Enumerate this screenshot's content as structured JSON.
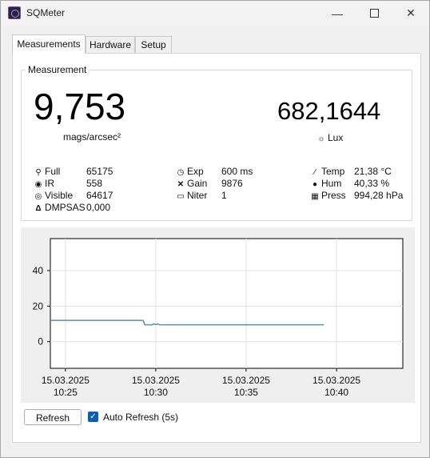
{
  "window": {
    "title": "SQMeter"
  },
  "tabs": [
    {
      "label": "Measurements",
      "active": true
    },
    {
      "label": "Hardware",
      "active": false
    },
    {
      "label": "Setup",
      "active": false
    }
  ],
  "measurement": {
    "group_label": "Measurement",
    "mags_value": "9,753",
    "mags_unit": "mags/arcsec²",
    "lux_value": "682,1644",
    "lux_unit": "Lux",
    "sensor": [
      {
        "icon": "bulb-icon",
        "label": "Full",
        "value": "65175"
      },
      {
        "icon": "ir-icon",
        "label": "IR",
        "value": "558"
      },
      {
        "icon": "eye-icon",
        "label": "Visible",
        "value": "64617"
      },
      {
        "icon": "delta-icon",
        "label": "DMPSAS",
        "value": "0,000"
      }
    ],
    "settings": [
      {
        "icon": "clock-icon",
        "label": "Exp",
        "value": "600 ms"
      },
      {
        "icon": "gain-icon",
        "label": "Gain",
        "value": "9876"
      },
      {
        "icon": "iter-icon",
        "label": "Niter",
        "value": "1"
      }
    ],
    "environment": [
      {
        "icon": "thermometer-icon",
        "label": "Temp",
        "value": "21,38 °C"
      },
      {
        "icon": "drop-icon",
        "label": "Hum",
        "value": "40,33 %"
      },
      {
        "icon": "pressure-icon",
        "label": "Press",
        "value": "994,28 hPa"
      }
    ]
  },
  "chart_data": {
    "type": "line",
    "y_ticks": [
      "0",
      "20",
      "40"
    ],
    "ylim": [
      -15,
      58
    ],
    "x_ticks": [
      {
        "date": "15.03.2025",
        "time": "10:25",
        "t": 10.4167
      },
      {
        "date": "15.03.2025",
        "time": "10:30",
        "t": 10.5
      },
      {
        "date": "15.03.2025",
        "time": "10:35",
        "t": 10.5833
      },
      {
        "date": "15.03.2025",
        "time": "10:40",
        "t": 10.6667
      }
    ],
    "xlim": [
      10.4028,
      10.7278
    ],
    "grid": true,
    "line_color": "#5b8fb4",
    "series": [
      {
        "x": [
          10.4028,
          10.4883,
          10.49,
          10.4967,
          10.4983,
          10.5,
          10.5017,
          10.5033,
          10.51,
          10.58,
          10.655
        ],
        "y": [
          12,
          12,
          9.5,
          9.5,
          10,
          9.5,
          10,
          9.5,
          9.5,
          9.5,
          9.5
        ]
      }
    ]
  },
  "footer": {
    "refresh_label": "Refresh",
    "auto_refresh_label": "Auto Refresh (5s)",
    "auto_refresh_checked": true
  }
}
